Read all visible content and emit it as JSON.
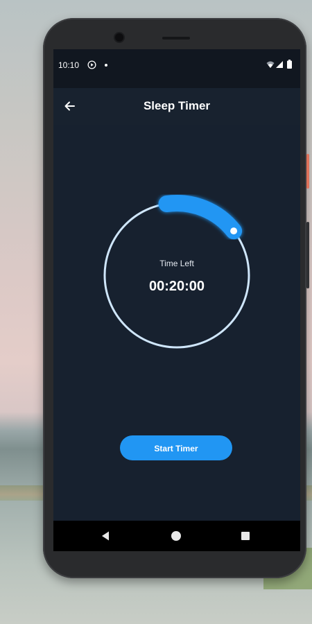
{
  "status_bar": {
    "time": "10:10",
    "icons": [
      "play-icon",
      "dot-icon",
      "wifi-icon",
      "signal-icon",
      "battery-icon"
    ]
  },
  "app_bar": {
    "title": "Sleep Timer",
    "back_icon": "arrow-left-icon"
  },
  "timer": {
    "label": "Time Left",
    "value": "00:20:00",
    "progress_fraction": 0.167
  },
  "actions": {
    "start_label": "Start Timer"
  },
  "nav_bar": {
    "icons": [
      "nav-back-icon",
      "nav-home-icon",
      "nav-recents-icon"
    ]
  },
  "colors": {
    "accent": "#2196f3",
    "ring": "#cfe6fb",
    "screen_background": "#17212f",
    "status_bar_background": "#111720"
  }
}
